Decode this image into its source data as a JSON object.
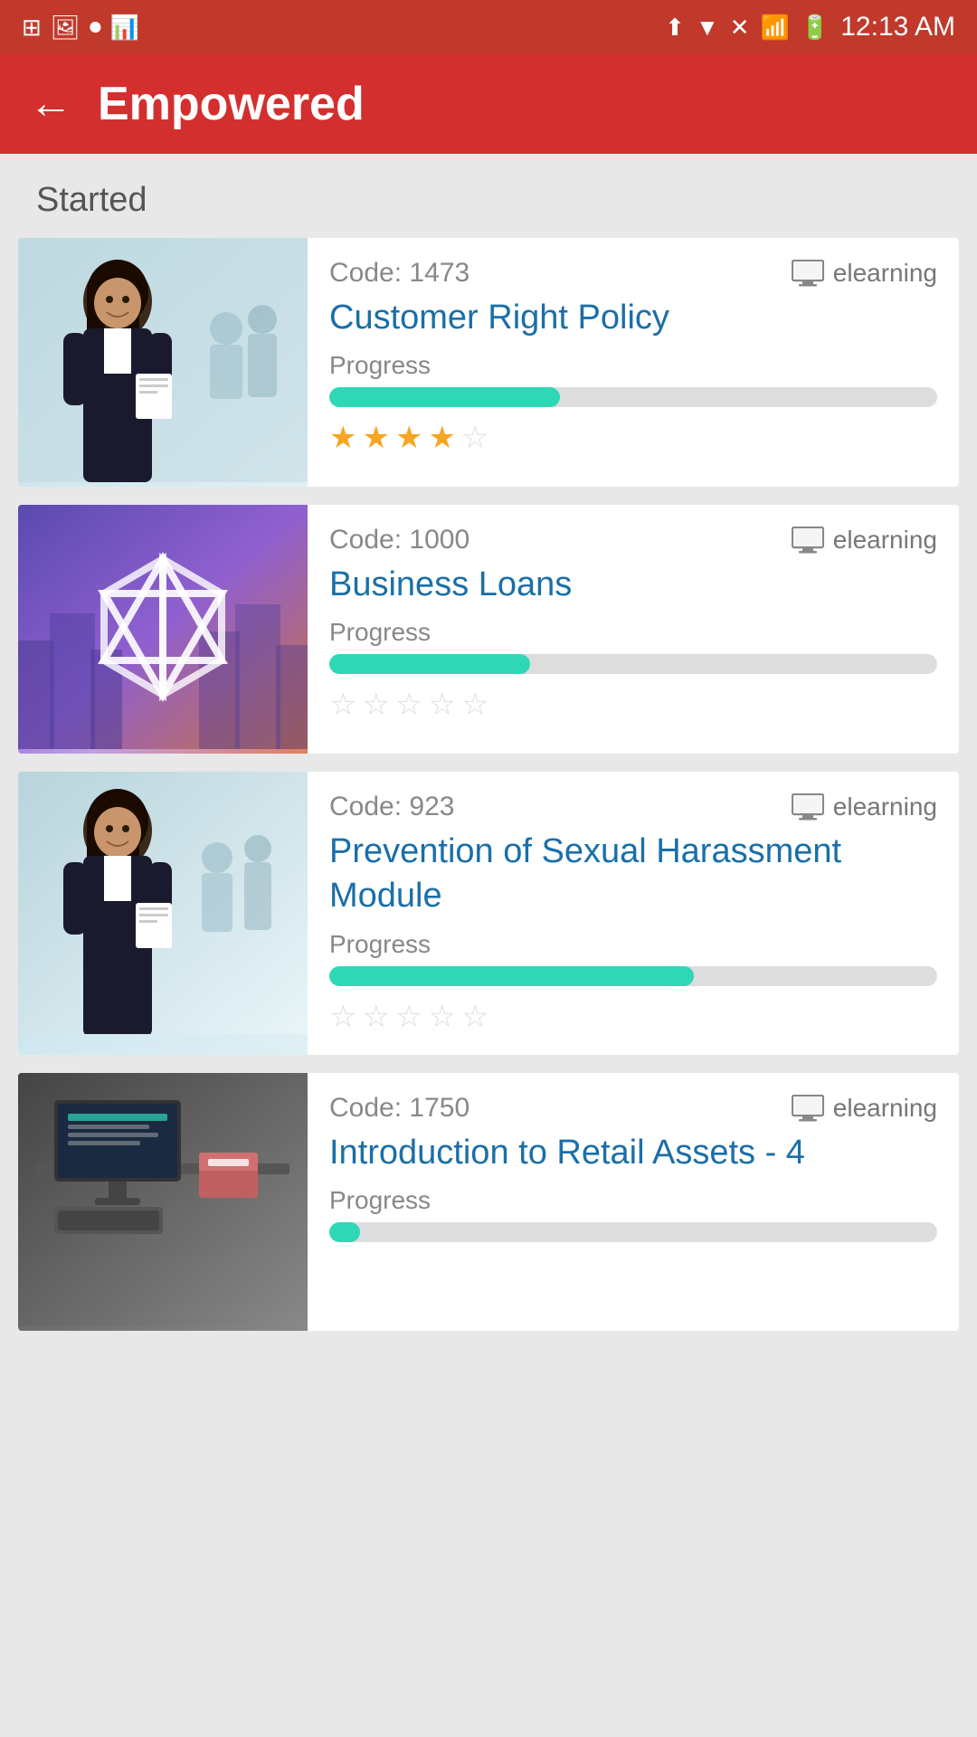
{
  "statusBar": {
    "time": "12:13 AM",
    "icons": [
      "grid-icon",
      "photo-icon",
      "record-icon",
      "chart-icon"
    ]
  },
  "header": {
    "backLabel": "←",
    "title": "Empowered"
  },
  "section": {
    "label": "Started"
  },
  "courses": [
    {
      "id": "course-1",
      "code": "Code: 1473",
      "type": "elearning",
      "title": "Customer Right Policy",
      "progressLabel": "Progress",
      "progressPercent": 38,
      "stars": [
        true,
        true,
        true,
        true,
        false
      ],
      "imageType": "img-customer"
    },
    {
      "id": "course-2",
      "code": "Code: 1000",
      "type": "elearning",
      "title": "Business Loans",
      "progressLabel": "Progress",
      "progressPercent": 33,
      "stars": [
        false,
        false,
        false,
        false,
        false
      ],
      "imageType": "img-business"
    },
    {
      "id": "course-3",
      "code": "Code: 923",
      "type": "elearning",
      "title": "Prevention of Sexual Harassment Module",
      "progressLabel": "Progress",
      "progressPercent": 60,
      "stars": [
        false,
        false,
        false,
        false,
        false
      ],
      "imageType": "img-prevention"
    },
    {
      "id": "course-4",
      "code": "Code: 1750",
      "type": "elearning",
      "title": "Introduction to Retail Assets - 4",
      "progressLabel": "Progress",
      "progressPercent": 5,
      "stars": [],
      "imageType": "img-retail"
    }
  ],
  "icons": {
    "back": "←",
    "computer": "💻",
    "starFilled": "★",
    "starEmpty": "☆"
  }
}
